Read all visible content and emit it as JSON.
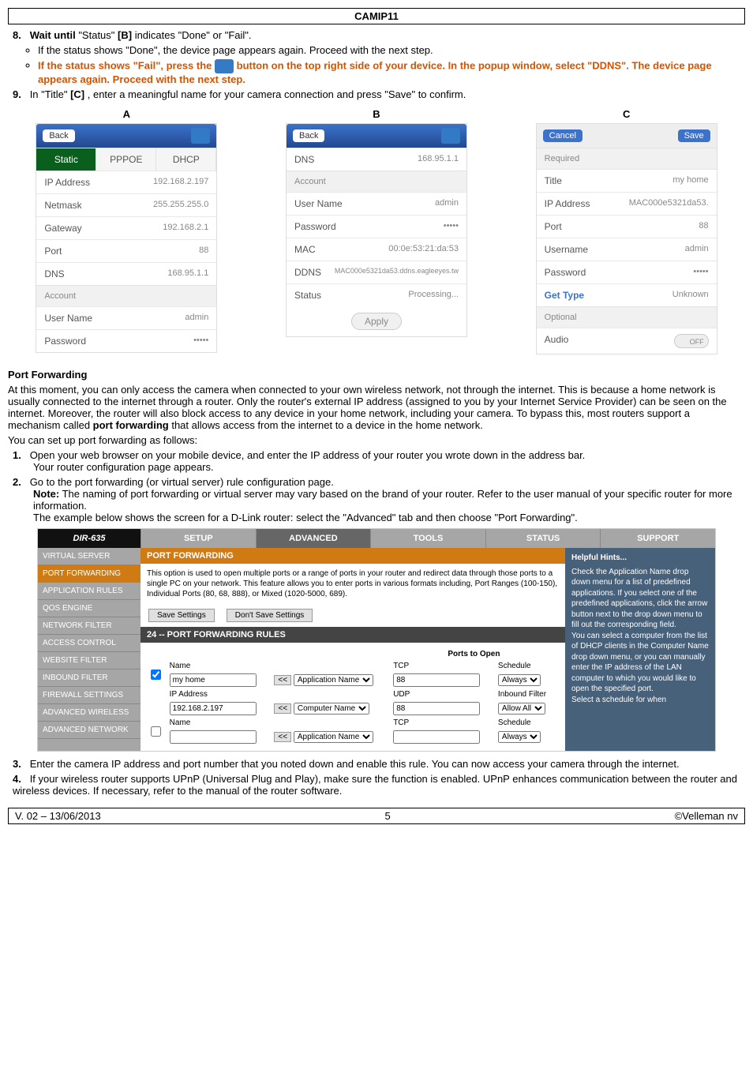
{
  "header_title": "CAMIP11",
  "instr_8": {
    "num": "8.",
    "lead": "Wait until ",
    "status": "\"Status\" ",
    "ref": "[B]",
    "tail": " indicates \"Done\" or \"Fail\"."
  },
  "instr_8a": "If the status shows \"Done\", the device page appears again. Proceed with the next step.",
  "instr_8b_pre": "If the status shows \"Fail\", press the ",
  "instr_8b_post": " button on the top right side of your device. In the popup window, select \"DDNS\". The device page appears again. Proceed with the next step.",
  "instr_9": {
    "num": "9.",
    "pre": "In \"Title\" ",
    "ref": "[C]",
    "post": ", enter a meaningful name for your camera connection and press \"Save\" to confirm."
  },
  "labels": {
    "A": "A",
    "B": "B",
    "C": "C"
  },
  "panelA": {
    "back": "Back",
    "tabs": {
      "static": "Static",
      "pppoe": "PPPOE",
      "dhcp": "DHCP"
    },
    "rows": {
      "ip_label": "IP Address",
      "ip_val": "192.168.2.197",
      "mask_label": "Netmask",
      "mask_val": "255.255.255.0",
      "gw_label": "Gateway",
      "gw_val": "192.168.2.1",
      "port_label": "Port",
      "port_val": "88",
      "dns_label": "DNS",
      "dns_val": "168.95.1.1"
    },
    "section_account": "Account",
    "user_label": "User Name",
    "user_val": "admin",
    "pass_label": "Password",
    "pass_val": "•••••"
  },
  "panelB": {
    "back": "Back",
    "rows": {
      "dns_label": "DNS",
      "dns_val": "168.95.1.1",
      "section_account": "Account",
      "user_label": "User Name",
      "user_val": "admin",
      "pass_label": "Password",
      "pass_val": "•••••",
      "mac_label": "MAC",
      "mac_val": "00:0e:53:21:da:53",
      "ddns_label": "DDNS",
      "ddns_val": "MAC000e5321da53.ddns.eagleeyes.tw",
      "status_label": "Status",
      "status_val": "Processing..."
    },
    "apply": "Apply"
  },
  "panelC": {
    "cancel": "Cancel",
    "save": "Save",
    "section_required": "Required",
    "rows": {
      "title_label": "Title",
      "title_val": "my home",
      "ip_label": "IP Address",
      "ip_val": "MAC000e5321da53.",
      "port_label": "Port",
      "port_val": "88",
      "user_label": "Username",
      "user_val": "admin",
      "pass_label": "Password",
      "pass_val": "•••••",
      "gettype_label": "Get Type",
      "gettype_val": "Unknown"
    },
    "section_optional": "Optional",
    "audio_label": "Audio",
    "audio_val": "OFF"
  },
  "port_forwarding_head": "Port Forwarding",
  "pf_para1": "At this moment, you can only access the camera when connected to your own wireless network, not through the internet. This is because a home network is usually connected to the internet through a router. Only the router's external IP address (assigned to you by your Internet Service Provider) can be seen on the internet. Moreover, the router will also block access to any device in your home network, including your camera. To bypass this, most routers support a mechanism called ",
  "pf_para1_bold": "port forwarding",
  "pf_para1_tail": " that allows access from the internet to a device in the home network.",
  "pf_para2": "You can set up port forwarding as follows:",
  "pf_step1_num": "1.",
  "pf_step1": "Open your web browser on your mobile device, and enter the IP address of your router you wrote down in the address bar.",
  "pf_step1b": "Your router configuration page appears.",
  "pf_step2_num": "2.",
  "pf_step2a": "Go to the port forwarding (or virtual server) rule configuration page.",
  "pf_note_label": "Note:",
  "pf_step2b": " The naming of port forwarding or virtual server may vary based on the brand of your router. Refer to the user manual of your specific router for more information.",
  "pf_step2c": "The example below shows the screen for a D-Link router: select the \"Advanced\" tab and then choose \"Port Forwarding\".",
  "dlink": {
    "logo": "DIR-635",
    "nav": [
      "SETUP",
      "ADVANCED",
      "TOOLS",
      "STATUS",
      "SUPPORT"
    ],
    "side": [
      "VIRTUAL SERVER",
      "PORT FORWARDING",
      "APPLICATION RULES",
      "QOS ENGINE",
      "NETWORK FILTER",
      "ACCESS CONTROL",
      "WEBSITE FILTER",
      "INBOUND FILTER",
      "FIREWALL SETTINGS",
      "ADVANCED WIRELESS",
      "ADVANCED NETWORK"
    ],
    "main_head": "PORT FORWARDING",
    "main_desc": "This option is used to open multiple ports or a range of ports in your router and redirect data through those ports to a single PC on your network. This feature allows you to enter ports in various formats including, Port Ranges (100-150), Individual Ports (80, 68, 888), or Mixed (1020-5000, 689).",
    "btn_save": "Save Settings",
    "btn_dont": "Don't Save Settings",
    "rules_head": "24 -- PORT FORWARDING RULES",
    "col_ports": "Ports to Open",
    "col_name": "Name",
    "col_tcp": "TCP",
    "col_udp": "UDP",
    "col_schedule": "Schedule",
    "col_inbound": "Inbound Filter",
    "row1_name": "my home",
    "row1_app": "Application Name",
    "row1_tcp": "88",
    "row1_schedule": "Always",
    "row1_ip_label": "IP Address",
    "row1_ip": "192.168.2.197",
    "row1_comp": "Computer Name",
    "row1_udp": "88",
    "row1_inbound": "Allow All",
    "row2_name": "Name",
    "row2_app": "Application Name",
    "row2_tcp": "TCP",
    "row2_schedule": "Schedule",
    "row2_inbound": "Always",
    "hints_head": "Helpful Hints...",
    "hints_body": "Check the Application Name drop down menu for a list of predefined applications. If you select one of the predefined applications, click the arrow button next to the drop down menu to fill out the corresponding field.\nYou can select a computer from the list of DHCP clients in the Computer Name drop down menu, or you can manually enter the IP address of the LAN computer to which you would like to open the specified port.\nSelect a schedule for when"
  },
  "pf_step3_num": "3.",
  "pf_step3": "Enter the camera IP address and port number that you noted down and enable this rule. You can now access your camera through the internet.",
  "pf_step4_num": "4.",
  "pf_step4": "If your wireless router supports UPnP (Universal Plug and Play), make sure the function is enabled. UPnP enhances communication between the router and wireless devices. If necessary, refer to the manual of the router software.",
  "footer": {
    "left": "V. 02 – 13/06/2013",
    "center": "5",
    "right": "©Velleman nv"
  }
}
